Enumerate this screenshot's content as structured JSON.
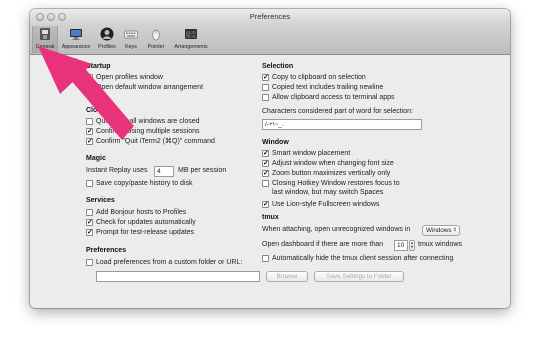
{
  "window": {
    "title": "Preferences"
  },
  "toolbar": {
    "tabs": [
      {
        "label": "General",
        "icon": "switch-icon"
      },
      {
        "label": "Appearance",
        "icon": "monitor-icon"
      },
      {
        "label": "Profiles",
        "icon": "person-icon"
      },
      {
        "label": "Keys",
        "icon": "keyboard-icon"
      },
      {
        "label": "Pointer",
        "icon": "mouse-icon"
      },
      {
        "label": "Arrangements",
        "icon": "window-arrangement-icon"
      }
    ],
    "selected": "General"
  },
  "startup": {
    "header": "Startup",
    "open_profiles": {
      "label": "Open profiles window",
      "checked": false
    },
    "open_default_arrangement": {
      "label": "Open default window arrangement",
      "checked": true
    }
  },
  "closing": {
    "header": "Closing",
    "quit_when_closed": {
      "label": "Quit when all windows are closed",
      "checked": false
    },
    "confirm_closing_multiple": {
      "label": "Confirm closing multiple sessions",
      "checked": true
    },
    "confirm_quit": {
      "label": "Confirm \"Quit iTerm2 (⌘Q)\" command",
      "checked": true
    }
  },
  "magic": {
    "header": "Magic",
    "instant_replay_prefix": "Instant Replay uses",
    "instant_replay_value": "4",
    "instant_replay_suffix": "MB per session",
    "save_paste_history": {
      "label": "Save copy/paste history to disk",
      "checked": false
    }
  },
  "services": {
    "header": "Services",
    "bonjour": {
      "label": "Add Bonjour hosts to Profiles",
      "checked": false
    },
    "check_updates": {
      "label": "Check for updates automatically",
      "checked": true
    },
    "prompt_test_release": {
      "label": "Prompt for test-release updates",
      "checked": true
    }
  },
  "preferences": {
    "header": "Preferences",
    "load_custom": {
      "label": "Load preferences from a custom folder or URL:",
      "checked": false
    },
    "folder_value": "",
    "browse_label": "Browse",
    "save_settings_label": "Save Settings to Folder"
  },
  "selection": {
    "header": "Selection",
    "copy_on_selection": {
      "label": "Copy to clipboard on selection",
      "checked": true
    },
    "copied_text_newline": {
      "label": "Copied text includes trailing newline",
      "checked": false
    },
    "allow_clipboard_access": {
      "label": "Allow clipboard access to terminal apps",
      "checked": false
    },
    "word_chars_label": "Characters considered part of word for selection:",
    "word_chars_value": "/-+\\~_."
  },
  "window_section": {
    "header": "Window",
    "smart_placement": {
      "label": "Smart window placement",
      "checked": true
    },
    "adjust_font_size": {
      "label": "Adjust window when changing font size",
      "checked": true
    },
    "zoom_maximizes": {
      "label": "Zoom button maximizes vertically only",
      "checked": true
    },
    "closing_hotkey": {
      "label_line1": "Closing Hotkey Window restores focus to",
      "label_line2": "last window, but may switch Spaces",
      "checked": false
    },
    "lion_fullscreen": {
      "label": "Use Lion-style Fullscreen windows",
      "checked": true
    }
  },
  "tmux": {
    "header": "tmux",
    "attach_label": "When attaching, open unrecognized windows in",
    "attach_value": "Windows",
    "dashboard_prefix": "Open dashboard if there are more than",
    "dashboard_value": "10",
    "dashboard_suffix": "tmux windows",
    "auto_hide": {
      "label": "Automatically hide the tmux client session after connecting",
      "checked": false
    }
  },
  "annotation": {
    "arrow_color": "#e8337a"
  }
}
